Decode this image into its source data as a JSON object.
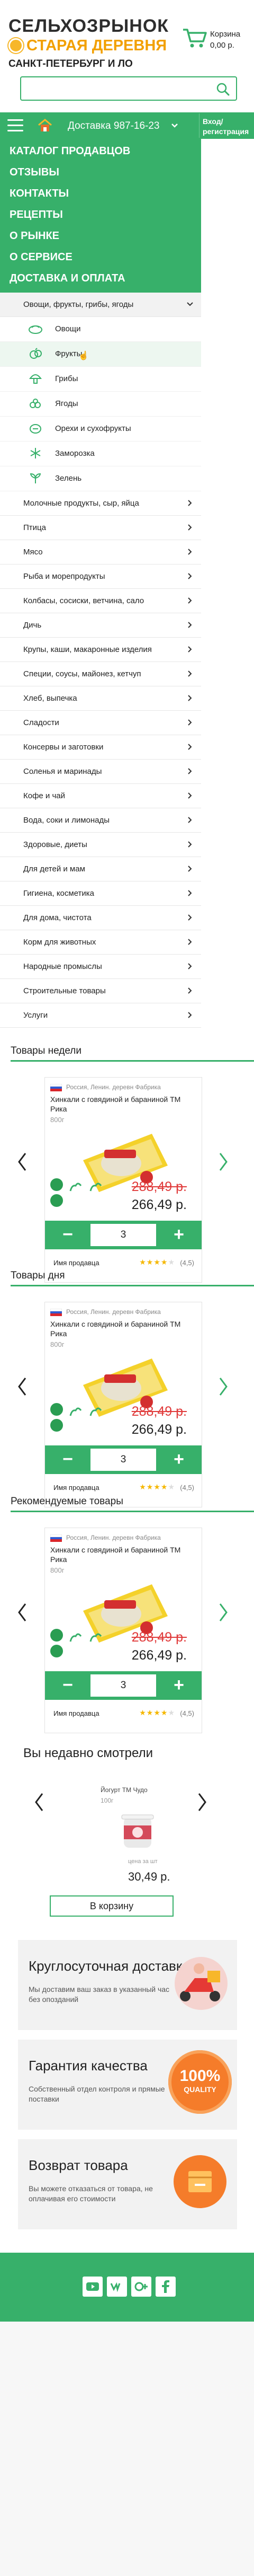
{
  "header": {
    "logo_line1": "СЕЛЬХОЗРЫНОК",
    "logo_line2": "СТАРАЯ ДЕРЕВНЯ",
    "city": "САНКТ-ПЕТЕРБУРГ И ЛО",
    "cart_label": "Корзина",
    "cart_total": "0,00 р.",
    "search_placeholder": "",
    "accent": "#37b06a"
  },
  "topbar": {
    "delivery": "Доставка  987-16-23",
    "login_line1": "Вход/",
    "login_line2": "регистрация"
  },
  "menu": {
    "items": [
      "КАТАЛОГ ПРОДАВЦОВ",
      "ОТЗЫВЫ",
      "КОНТАКТЫ",
      "РЕЦЕПТЫ",
      "О РЫНКЕ",
      "О СЕРВИСЕ",
      "ДОСТАВКА И ОПЛАТА"
    ]
  },
  "categories": {
    "open": "Овощи, фрукты, грибы, ягоды",
    "subs": [
      {
        "label": "Овощи",
        "icon": "vegetables-icon"
      },
      {
        "label": "Фрукты",
        "icon": "fruits-icon"
      },
      {
        "label": "Грибы",
        "icon": "mushrooms-icon"
      },
      {
        "label": "Ягоды",
        "icon": "berries-icon"
      },
      {
        "label": "Орехи и сухофрукты",
        "icon": "nuts-icon"
      },
      {
        "label": "Заморозка",
        "icon": "frozen-icon"
      },
      {
        "label": "Зелень",
        "icon": "greens-icon"
      }
    ],
    "list": [
      "Молочные продукты, сыр, яйца",
      "Птица",
      "Мясо",
      "Рыба и морепродукты",
      "Колбасы, сосиски, ветчина, сало",
      "Дичь",
      "Крупы, каши, макаронные изделия",
      "Специи, соусы, майонез, кетчуп",
      "Хлеб, выпечка",
      "Сладости",
      "Консервы и заготовки",
      "Соленья и маринады",
      "Кофе и чай",
      "Вода, соки и лимонады",
      "Здоровые, диеты",
      "Для детей и мам",
      "Гигиена, косметика",
      "Для дома, чистота",
      "Корм для животных",
      "Народные промыслы",
      "Строительные товары",
      "Услуги"
    ]
  },
  "sections": [
    {
      "title": "Товары недели"
    },
    {
      "title": "Товары дня"
    },
    {
      "title": "Рекомендуемые товары"
    }
  ],
  "product": {
    "country": "Россия, Ленин. деревн Фабрика",
    "name": "Хинкали с говядиной и бараниной ТМ Рика",
    "weight": "800г",
    "old_price": "288,49 р.",
    "new_price": "266,49 р.",
    "qty": "3",
    "minus": "−",
    "plus": "+",
    "no_seller": "Имя продавца",
    "rating_text": "(4,5)",
    "rating": 4.5
  },
  "recent": {
    "title": "Вы недавно смотрели",
    "name": "Йогурт ТМ Чудо",
    "weight": "100г",
    "unit": "цена за шт",
    "price": "30,49 р.",
    "button": "В корзину"
  },
  "features": [
    {
      "title": "Круглосуточная доставка",
      "desc": "Мы доставим ваш заказ в указанный час без опозданий",
      "icon": "delivery-scooter-icon"
    },
    {
      "title": "Гарантия качества",
      "desc": "Собственный отдел контроля и прямые поставки",
      "icon": "quality-badge-icon",
      "badge_line1": "100%",
      "badge_line2": "QUALITY"
    },
    {
      "title": "Возврат товара",
      "desc": "Вы можете отказаться от товара, не оплачивая его стоимости",
      "icon": "return-box-icon"
    }
  ],
  "footer": {
    "socials": [
      "youtube-icon",
      "vk-icon",
      "google-plus-icon",
      "facebook-icon"
    ]
  }
}
